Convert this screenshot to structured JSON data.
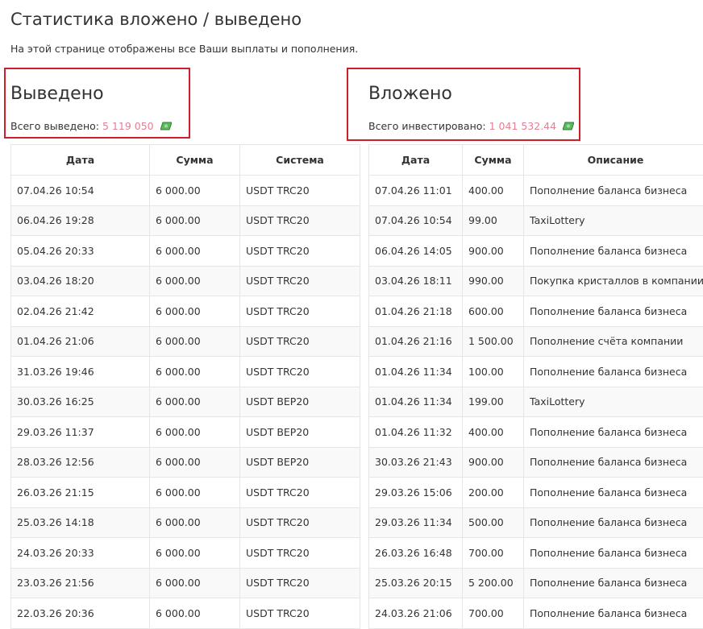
{
  "page": {
    "title": "Статистика вложено / выведено",
    "description": "На этой странице отображены все Ваши выплаты и пополнения."
  },
  "withdrawn": {
    "title": "Выведено",
    "total_label": "Всего выведено:",
    "total_value": "5 119 050",
    "total_icon": "money-icon",
    "columns": [
      "Дата",
      "Сумма",
      "Система"
    ],
    "rows": [
      [
        "07.04.26 10:54",
        "6 000.00",
        "USDT TRC20"
      ],
      [
        "06.04.26 19:28",
        "6 000.00",
        "USDT TRC20"
      ],
      [
        "05.04.26 20:33",
        "6 000.00",
        "USDT TRC20"
      ],
      [
        "03.04.26 18:20",
        "6 000.00",
        "USDT TRC20"
      ],
      [
        "02.04.26 21:42",
        "6 000.00",
        "USDT TRC20"
      ],
      [
        "01.04.26 21:06",
        "6 000.00",
        "USDT TRC20"
      ],
      [
        "31.03.26 19:46",
        "6 000.00",
        "USDT TRC20"
      ],
      [
        "30.03.26 16:25",
        "6 000.00",
        "USDT BEP20"
      ],
      [
        "29.03.26 11:37",
        "6 000.00",
        "USDT BEP20"
      ],
      [
        "28.03.26 12:56",
        "6 000.00",
        "USDT BEP20"
      ],
      [
        "26.03.26 21:15",
        "6 000.00",
        "USDT TRC20"
      ],
      [
        "25.03.26 14:18",
        "6 000.00",
        "USDT TRC20"
      ],
      [
        "24.03.26 20:33",
        "6 000.00",
        "USDT TRC20"
      ],
      [
        "23.03.26 21:56",
        "6 000.00",
        "USDT TRC20"
      ],
      [
        "22.03.26 20:36",
        "6 000.00",
        "USDT TRC20"
      ]
    ]
  },
  "invested": {
    "title": "Вложено",
    "total_label": "Всего инвестировано:",
    "total_value": "1 041 532.44",
    "total_icon": "money-icon",
    "columns": [
      "Дата",
      "Сумма",
      "Описание"
    ],
    "rows": [
      [
        "07.04.26 11:01",
        "400.00",
        "Пополнение баланса бизнеса"
      ],
      [
        "07.04.26 10:54",
        "99.00",
        "TaxiLottery"
      ],
      [
        "06.04.26 14:05",
        "900.00",
        "Пополнение баланса бизнеса"
      ],
      [
        "03.04.26 18:11",
        "990.00",
        "Покупка кристаллов в компании"
      ],
      [
        "01.04.26 21:18",
        "600.00",
        "Пополнение баланса бизнеса"
      ],
      [
        "01.04.26 21:16",
        "1 500.00",
        "Пополнение счёта компании"
      ],
      [
        "01.04.26 11:34",
        "100.00",
        "Пополнение баланса бизнеса"
      ],
      [
        "01.04.26 11:34",
        "199.00",
        "TaxiLottery"
      ],
      [
        "01.04.26 11:32",
        "400.00",
        "Пополнение баланса бизнеса"
      ],
      [
        "30.03.26 21:43",
        "900.00",
        "Пополнение баланса бизнеса"
      ],
      [
        "29.03.26 15:06",
        "200.00",
        "Пополнение баланса бизнеса"
      ],
      [
        "29.03.26 11:34",
        "500.00",
        "Пополнение баланса бизнеса"
      ],
      [
        "26.03.26 16:48",
        "700.00",
        "Пополнение баланса бизнеса"
      ],
      [
        "25.03.26 20:15",
        "5 200.00",
        "Пополнение баланса бизнеса"
      ],
      [
        "24.03.26 21:06",
        "700.00",
        "Пополнение баланса бизнеса"
      ]
    ]
  },
  "colors": {
    "total_value": "#e57e97",
    "highlight_border": "#cc1f2a",
    "table_border": "#e6e6e6",
    "row_stripe": "#f9f9f9",
    "money_icon": "#5cb85c"
  }
}
